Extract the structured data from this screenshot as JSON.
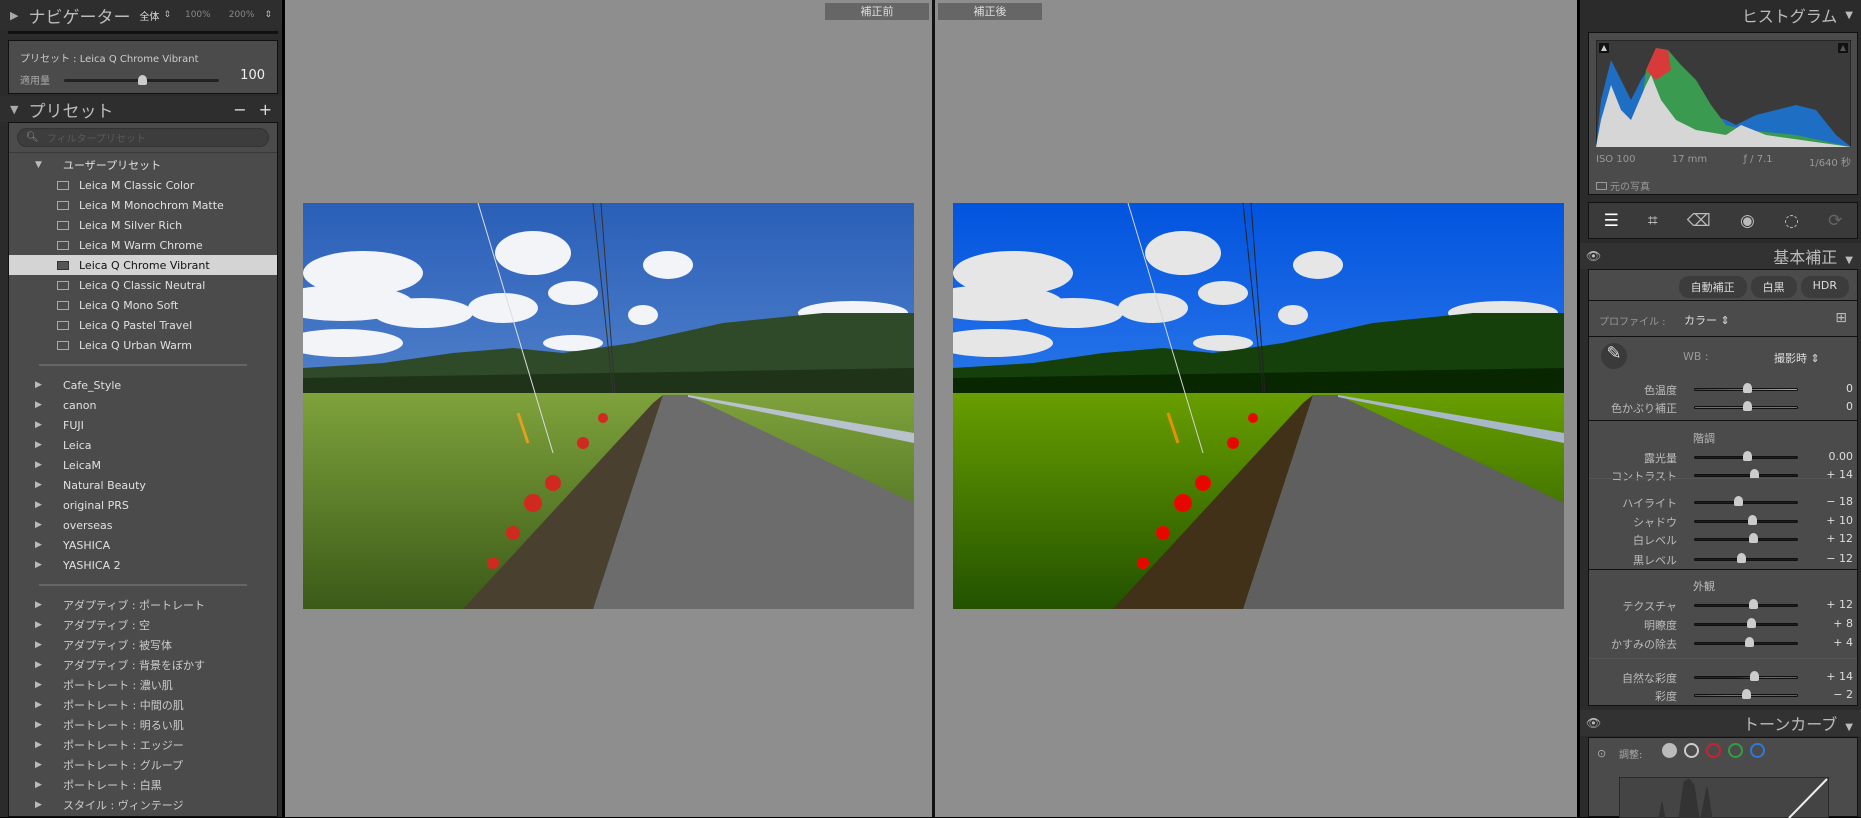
{
  "navigator": {
    "title": "ナビゲーター",
    "zoom_fit": "全体",
    "zoom_100": "100%",
    "zoom_200": "200%"
  },
  "preset_amount": {
    "label_preset": "プリセット : Leica Q Chrome Vibrant",
    "label_amount": "適用量",
    "value": "100",
    "fraction": 0.5
  },
  "presets": {
    "title": "プリセット",
    "minus": "−",
    "plus": "+",
    "search_placeholder": "フィルタープリセット",
    "user_group": "ユーザープリセット",
    "user_items": [
      "Leica M Classic Color",
      "Leica M Monochrom Matte",
      "Leica M Silver Rich",
      "Leica M Warm Chrome",
      "Leica Q Chrome Vibrant",
      "Leica Q Classic Neutral",
      "Leica Q Mono Soft",
      "Leica Q Pastel Travel",
      "Leica Q Urban Warm"
    ],
    "folders": [
      "Cafe_Style",
      "canon",
      "FUJI",
      "Leica",
      "LeicaM",
      "Natural Beauty",
      "original PRS",
      "overseas",
      "YASHICA",
      "YASHICA 2"
    ],
    "adobe": [
      "アダプティブ : ポートレート",
      "アダプティブ : 空",
      "アダプティブ : 被写体",
      "アダプティブ : 背景をぼかす",
      "ポートレート : 濃い肌",
      "ポートレート : 中間の肌",
      "ポートレート : 明るい肌",
      "ポートレート : エッジー",
      "ポートレート : グループ",
      "ポートレート : 白黒",
      "スタイル : ヴィンテージ"
    ]
  },
  "view": {
    "before": "補正前",
    "after": "補正後"
  },
  "histogram": {
    "title": "ヒストグラム",
    "iso": "ISO 100",
    "focal": "17 mm",
    "aperture": "ƒ / 7.1",
    "shutter": "1/640 秒",
    "original_photo": "元の写真"
  },
  "basic": {
    "title": "基本補正",
    "auto": "自動補正",
    "bw": "白黒",
    "hdr": "HDR",
    "profile_label": "プロファイル :",
    "profile_value": "カラー",
    "wb_label": "WB :",
    "wb_value": "撮影時",
    "tone_label": "階調",
    "presence_label": "外観",
    "sliders": [
      {
        "label": "色温度",
        "value": "0",
        "fraction": 0.5
      },
      {
        "label": "色かぶり補正",
        "value": "0",
        "fraction": 0.5
      },
      {
        "label": "露光量",
        "value": "0.00",
        "fraction": 0.5
      },
      {
        "label": "コントラスト",
        "value": "+ 14",
        "fraction": 0.57
      },
      {
        "label": "ハイライト",
        "value": "− 18",
        "fraction": 0.41
      },
      {
        "label": "シャドウ",
        "value": "+ 10",
        "fraction": 0.55
      },
      {
        "label": "白レベル",
        "value": "+ 12",
        "fraction": 0.56
      },
      {
        "label": "黒レベル",
        "value": "− 12",
        "fraction": 0.44
      },
      {
        "label": "テクスチャ",
        "value": "+ 12",
        "fraction": 0.56
      },
      {
        "label": "明瞭度",
        "value": "+ 8",
        "fraction": 0.54
      },
      {
        "label": "かすみの除去",
        "value": "+ 4",
        "fraction": 0.52
      },
      {
        "label": "自然な彩度",
        "value": "+ 14",
        "fraction": 0.57
      },
      {
        "label": "彩度",
        "value": "− 2",
        "fraction": 0.49
      }
    ]
  },
  "tone_curve": {
    "title": "トーンカーブ",
    "adjust_label": "調整:"
  }
}
